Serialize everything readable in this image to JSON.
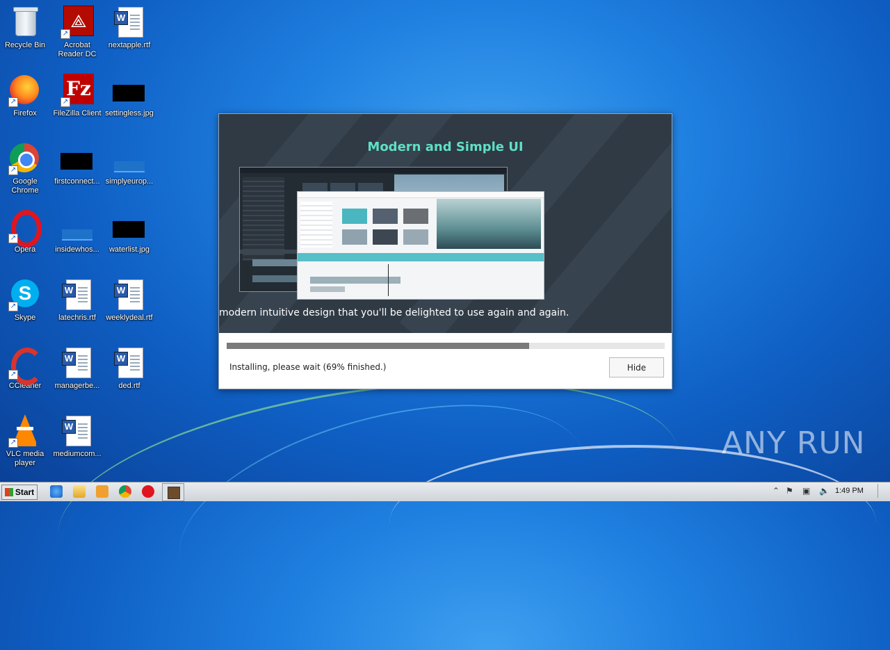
{
  "desktop_icons": [
    {
      "label": "Recycle Bin"
    },
    {
      "label": "Acrobat Reader DC"
    },
    {
      "label": "nextapple.rtf"
    },
    {
      "label": "Firefox"
    },
    {
      "label": "FileZilla Client"
    },
    {
      "label": "settingless.jpg"
    },
    {
      "label": "Google Chrome"
    },
    {
      "label": "firstconnect..."
    },
    {
      "label": "simplyeurop..."
    },
    {
      "label": "Opera"
    },
    {
      "label": "insidewhos..."
    },
    {
      "label": "waterlist.jpg"
    },
    {
      "label": "Skype"
    },
    {
      "label": "latechris.rtf"
    },
    {
      "label": "weeklydeal.rtf"
    },
    {
      "label": "CCleaner"
    },
    {
      "label": "managerbe..."
    },
    {
      "label": "ded.rtf"
    },
    {
      "label": "VLC media player"
    },
    {
      "label": "mediumcom..."
    }
  ],
  "installer": {
    "banner_title": "Modern and Simple UI",
    "banner_text": "modern intuitive design that you'll be delighted to use again and again.",
    "progress_percent": 69,
    "status_text": "Installing, please wait (69% finished.)",
    "hide_label": "Hide"
  },
  "taskbar": {
    "start_label": "Start",
    "clock": "1:49 PM"
  },
  "watermark": "ANY RUN",
  "colors": {
    "banner_bg": "#2f3a44",
    "banner_title": "#5fe0c6",
    "progress_fill": "#7a7a7a",
    "desktop_bg": "#1f7fe0"
  }
}
